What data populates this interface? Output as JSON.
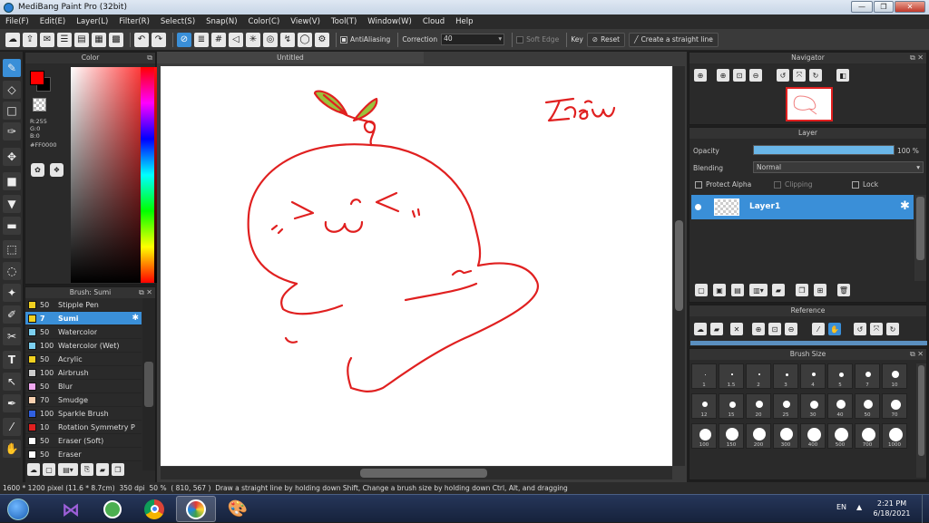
{
  "window": {
    "title": "MediBang Paint Pro (32bit)",
    "buttons": [
      "—",
      "❐",
      "✕"
    ]
  },
  "menu": [
    "File(F)",
    "Edit(E)",
    "Layer(L)",
    "Filter(R)",
    "Select(S)",
    "Snap(N)",
    "Color(C)",
    "View(V)",
    "Tool(T)",
    "Window(W)",
    "Cloud",
    "Help"
  ],
  "toolbar": {
    "antialiasing_label": "AntiAliasing",
    "correction_label": "Correction",
    "correction_value": "40",
    "soft_edge_label": "Soft Edge",
    "key_label": "Key",
    "reset_label": "Reset",
    "straight_line_label": "Create a straight line"
  },
  "color_panel": {
    "title": "Color",
    "r": "R:255",
    "g": "G:0",
    "b": "B:0",
    "hex": "#FF0000",
    "fg_color": "#ff0000"
  },
  "brush_panel": {
    "title": "Brush: Sumi",
    "items": [
      {
        "size": "50",
        "name": "Stipple Pen",
        "color": "#f0d020"
      },
      {
        "size": "7",
        "name": "Sumi",
        "color": "#f0d020",
        "selected": true
      },
      {
        "size": "50",
        "name": "Watercolor",
        "color": "#7cd0f0"
      },
      {
        "size": "100",
        "name": "Watercolor (Wet)",
        "color": "#7cd0f0"
      },
      {
        "size": "50",
        "name": "Acrylic",
        "color": "#f0d020"
      },
      {
        "size": "100",
        "name": "Airbrush",
        "color": "#cccccc"
      },
      {
        "size": "50",
        "name": "Blur",
        "color": "#f0a8f0"
      },
      {
        "size": "70",
        "name": "Smudge",
        "color": "#f8d0b0"
      },
      {
        "size": "100",
        "name": "Sparkle Brush",
        "color": "#3060e0"
      },
      {
        "size": "10",
        "name": "Rotation Symmetry P",
        "color": "#e02020"
      },
      {
        "size": "50",
        "name": "Eraser (Soft)",
        "color": "#ffffff"
      },
      {
        "size": "50",
        "name": "Eraser",
        "color": "#ffffff"
      }
    ]
  },
  "canvas": {
    "tab_title": "Untitled",
    "stroke_color": "#e02020",
    "leaf_color": "#9ac23c"
  },
  "navigator": {
    "title": "Navigator"
  },
  "layer_panel": {
    "title": "Layer",
    "opacity_label": "Opacity",
    "opacity_value": "100 %",
    "opacity_fraction": 1.0,
    "blending_label": "Blending",
    "blending_value": "Normal",
    "protect_alpha_label": "Protect Alpha",
    "clipping_label": "Clipping",
    "lock_label": "Lock",
    "layer_name": "Layer1"
  },
  "reference_panel": {
    "title": "Reference"
  },
  "brush_size_panel": {
    "title": "Brush Size",
    "sizes": [
      "1",
      "1.5",
      "2",
      "3",
      "4",
      "5",
      "7",
      "10",
      "12",
      "15",
      "20",
      "25",
      "30",
      "40",
      "50",
      "70",
      "100",
      "150",
      "200",
      "300",
      "400",
      "500",
      "700",
      "1000"
    ]
  },
  "status": {
    "size": "1600 * 1200 pixel",
    "cm": "(11.6 * 8.7cm)",
    "dpi": "350 dpi",
    "zoom": "50 %",
    "coords": "( 810, 567 )",
    "hint": "Draw a straight line by holding down Shift, Change a brush size by holding down Ctrl, Alt, and dragging"
  },
  "taskbar": {
    "lang": "EN",
    "time": "2:21 PM",
    "date": "6/18/2021"
  }
}
